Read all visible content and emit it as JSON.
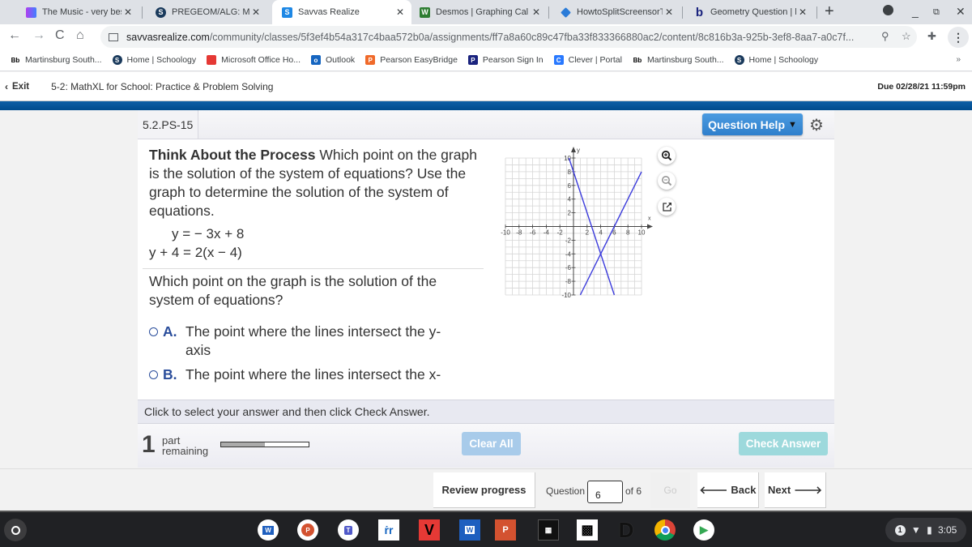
{
  "browser": {
    "tabs": [
      {
        "label": "The Music - very best A",
        "icon": "music-app-icon",
        "active": false
      },
      {
        "label": "PREGEOM/ALG: Mr. Bur",
        "icon": "schoology-icon",
        "active": false
      },
      {
        "label": "Savvas Realize",
        "icon": "savvas-icon",
        "active": true
      },
      {
        "label": "Desmos | Graphing Cal",
        "icon": "desmos-icon",
        "active": false
      },
      {
        "label": "HowtoSplitScreensorTa",
        "icon": "diamond-icon",
        "active": false
      },
      {
        "label": "Geometry Question | ba",
        "icon": "bartleby-icon",
        "active": false
      }
    ],
    "new_tab_label": "+",
    "url_host": "savvasrealize.com",
    "url_path": "/community/classes/5f3ef4b54a317c4baa572b0a/assignments/ff7a8a60c89c47fba33f833366880ac2/content/8c816b3a-925b-3ef8-8aa7-a0c7f...",
    "bookmarks": [
      {
        "label": "Martinsburg South...",
        "icon": "blackboard-icon"
      },
      {
        "label": "Home | Schoology",
        "icon": "schoology-icon"
      },
      {
        "label": "Microsoft Office Ho...",
        "icon": "office-icon"
      },
      {
        "label": "Outlook",
        "icon": "outlook-icon"
      },
      {
        "label": "Pearson EasyBridge",
        "icon": "pearson-icon"
      },
      {
        "label": "Pearson Sign In",
        "icon": "pearson-icon"
      },
      {
        "label": "Clever | Portal",
        "icon": "clever-icon"
      },
      {
        "label": "Martinsburg South...",
        "icon": "blackboard-icon"
      },
      {
        "label": "Home | Schoology",
        "icon": "schoology-icon"
      }
    ],
    "bookmarks_more": "»"
  },
  "app_header": {
    "exit_label": "Exit",
    "assignment_title": "5-2: MathXL for School: Practice & Problem Solving",
    "due": "Due 02/28/21 11:59pm"
  },
  "question": {
    "id": "5.2.PS-15",
    "help_label": "Question Help",
    "intro_bold": "Think About the Process",
    "intro_text": " Which point on the graph is the solution of the system of equations? Use the graph to determine the solution of the system of equations.",
    "equation1": "y = − 3x + 8",
    "equation2": "y + 4 = 2(x − 4)",
    "prompt": "Which point on the graph is the solution of the system of equations?",
    "choices": [
      {
        "letter": "A.",
        "text": "The point where the lines intersect the y-axis"
      },
      {
        "letter": "B.",
        "text": "The point where the lines intersect the x-axis"
      }
    ],
    "instruction": "Click to select your answer and then click Check Answer.",
    "parts_remaining_count": "1",
    "parts_remaining_label_1": "part",
    "parts_remaining_label_2": "remaining",
    "progress_fraction": 0.5,
    "clear_all_label": "Clear All",
    "check_answer_label": "Check Answer"
  },
  "graph": {
    "xlabel": "x",
    "ylabel": "y",
    "xlim": [
      -10,
      10
    ],
    "ylim": [
      -10,
      10
    ],
    "x_tick_labels": [
      "-10",
      "-8",
      "-6",
      "-4",
      "-2",
      "2",
      "4",
      "6",
      "8",
      "10"
    ],
    "y_tick_labels": [
      "10",
      "8",
      "6",
      "4",
      "2",
      "-2",
      "-4",
      "-6",
      "-8",
      "-10"
    ],
    "line_color": "#3b3bdc",
    "lines": [
      {
        "name": "y = -3x + 8",
        "slope": -3,
        "intercept": 8
      },
      {
        "name": "y + 4 = 2(x - 4)",
        "slope": 2,
        "intercept": -12
      }
    ],
    "tools": [
      "zoom-in-icon",
      "zoom-out-icon",
      "popout-icon"
    ]
  },
  "bottom_nav": {
    "review_label": "Review progress",
    "question_label": "Question",
    "question_value": "6",
    "of_label": "of 6",
    "go_label": "Go",
    "back_label": "Back",
    "next_label": "Next"
  },
  "shelf": {
    "apps": [
      "word-icon",
      "powerpoint-icon",
      "teams-icon",
      "reading-app-icon",
      "vivaldi-icon",
      "word-doc-icon",
      "powerpoint-doc-icon",
      "calculator-icon",
      "qr-code-icon",
      "docs-d-icon",
      "chrome-icon",
      "play-store-icon"
    ],
    "notification_count": "1",
    "time": "3:05"
  }
}
